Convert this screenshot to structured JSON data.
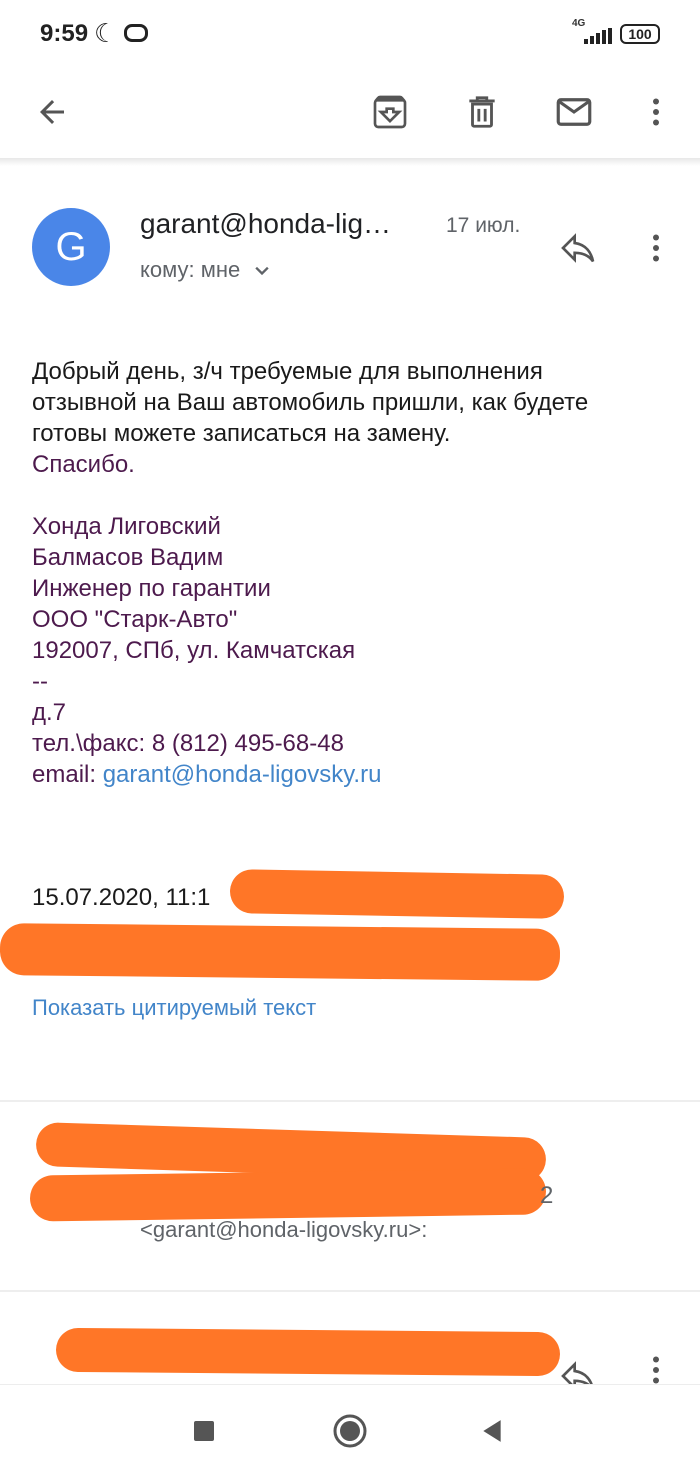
{
  "status_bar": {
    "time": "9:59",
    "network": "4G",
    "battery": "100"
  },
  "toolbar": {
    "icons": [
      "back-arrow-icon",
      "archive-icon",
      "delete-icon",
      "mark-unread-icon",
      "more-vert-icon"
    ]
  },
  "message": {
    "avatar_letter": "G",
    "sender": "garant@honda-lig…",
    "date": "17 июл.",
    "recipient": "кому: мне",
    "body": [
      "Добрый день, з/ч требуемые для выполнения",
      "отзывной на Ваш автомобиль пришли, как будете",
      "готовы можете записаться на замену."
    ],
    "thanks": "Спасибо.",
    "signature": [
      "Хонда Лиговский",
      "Балмасов Вадим",
      "Инженер по гарантии",
      "ООО \"Старк-Авто\"",
      "192007, СПб, ул. Камчатская",
      "--",
      "д.7",
      "тел.\\факс: 8 (812) 495-68-48"
    ],
    "email_label": "email: ",
    "email_link": "garant@honda-ligovsky.ru",
    "quote_header": "15.07.2020, 11:1",
    "show_quoted": "Показать цитируемый текст"
  },
  "second_message": {
    "trailing_digit": "2",
    "address": "<garant@honda-ligovsky.ru>:"
  },
  "colors": {
    "accent_blue": "#4285c9",
    "avatar_blue": "#4a86e8",
    "signature_purple": "#4d1a4d",
    "redaction_orange": "#ff7627"
  }
}
